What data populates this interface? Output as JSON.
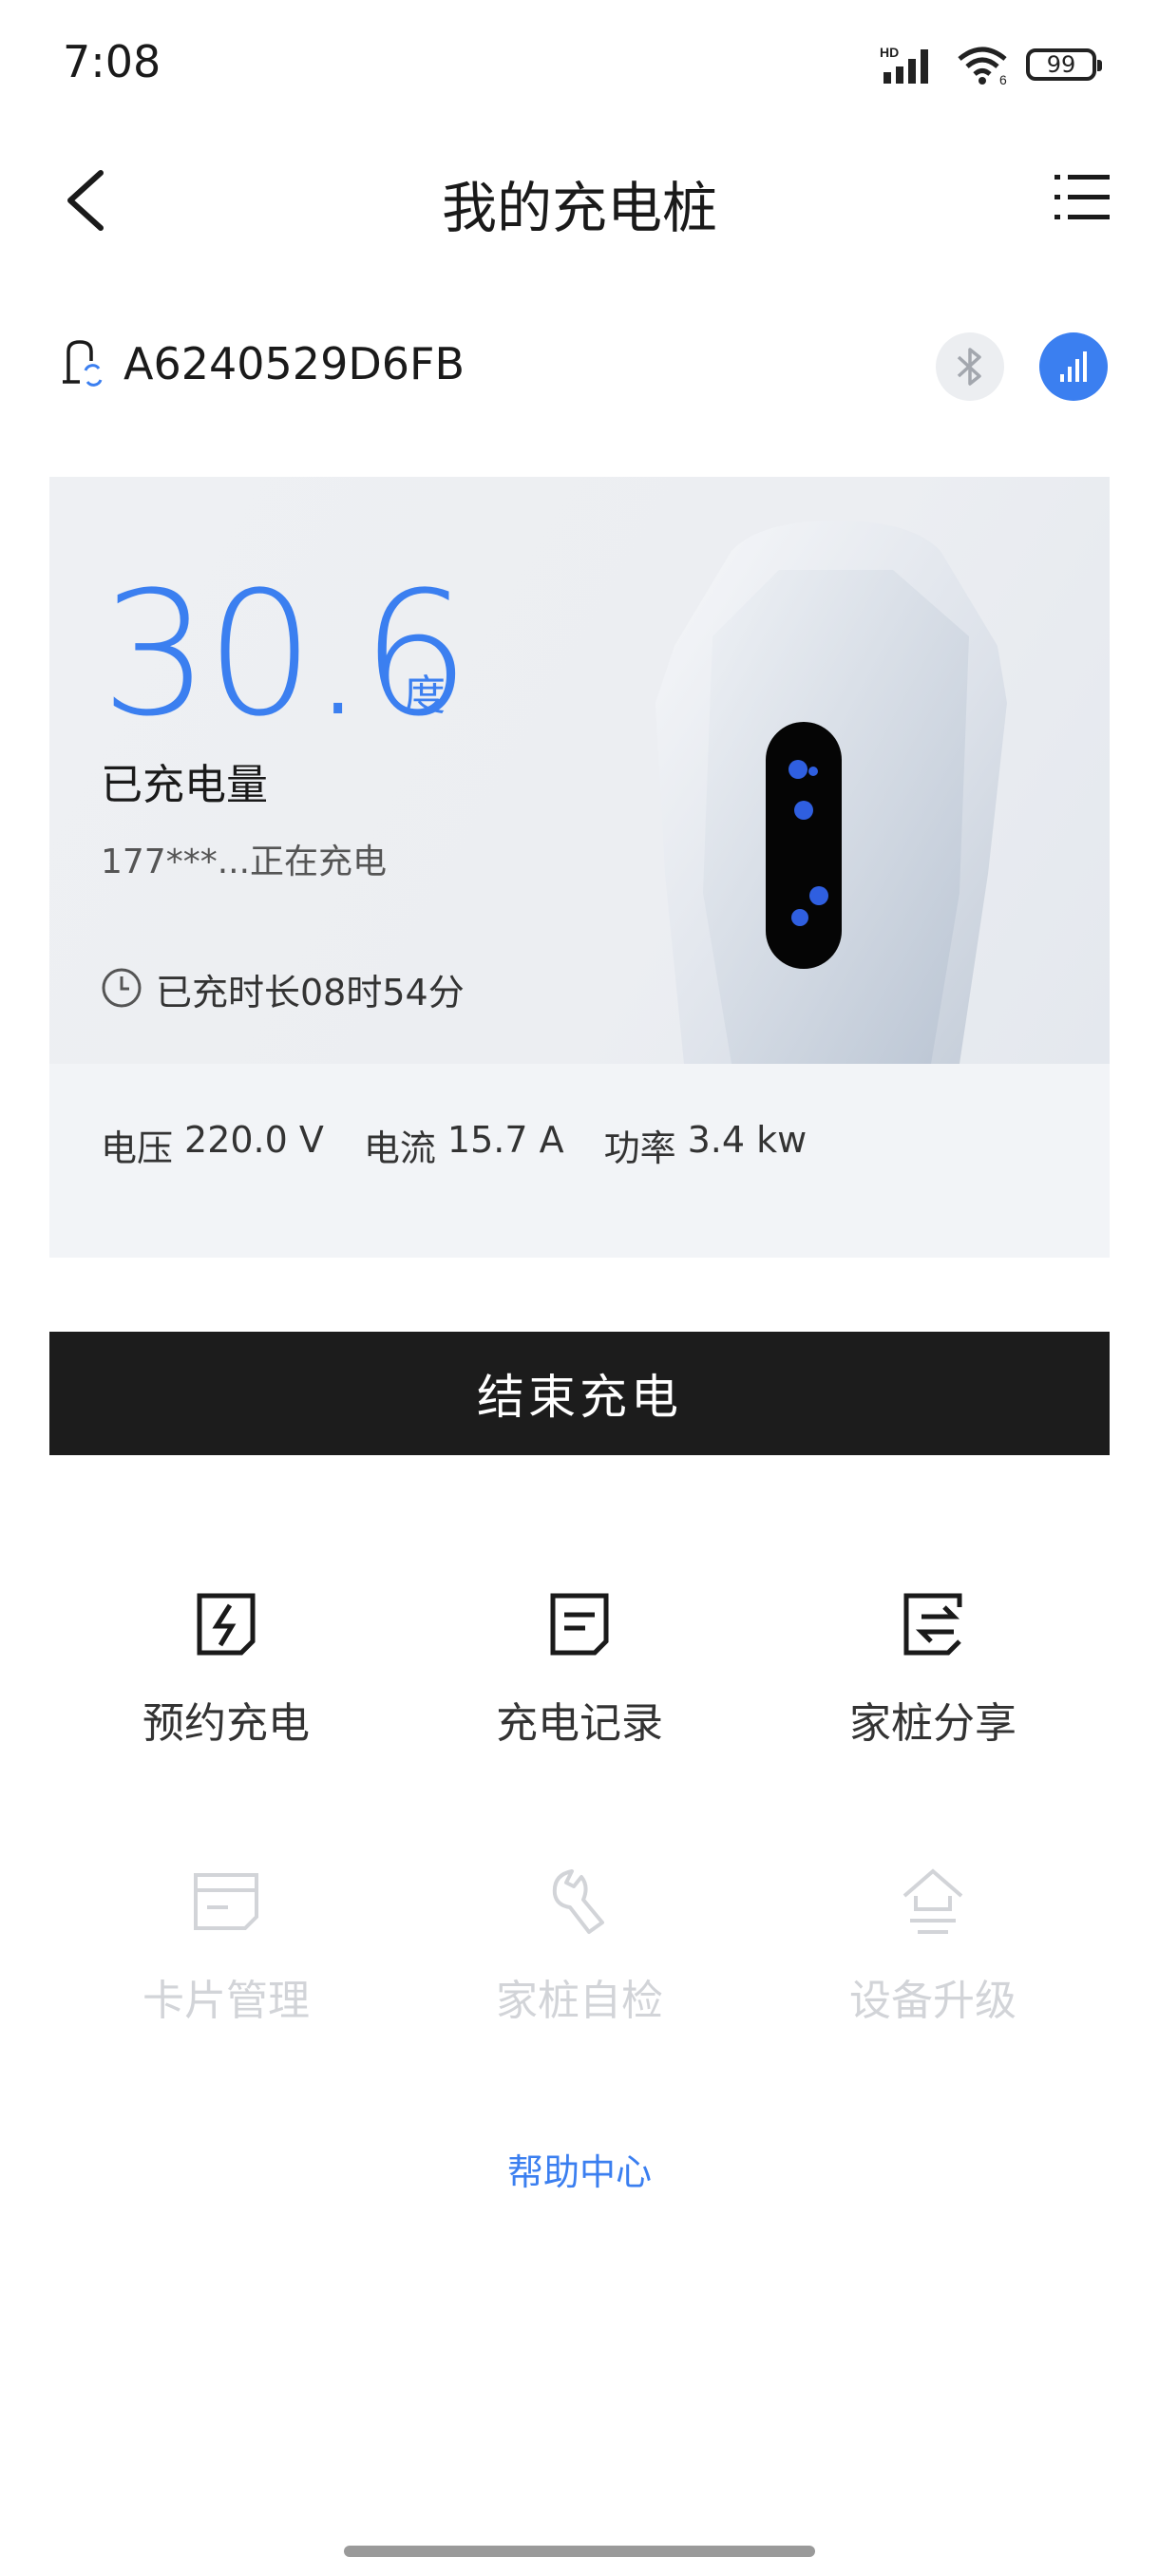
{
  "status_bar": {
    "time": "7:08",
    "network": "HD",
    "wifi_badge": "6",
    "battery": "99"
  },
  "header": {
    "title": "我的充电桩"
  },
  "device": {
    "id": "A6240529D6FB",
    "bluetooth_icon": "bluetooth-icon",
    "signal_icon": "signal-icon"
  },
  "charging": {
    "energy_value": "30.6",
    "energy_unit": "度",
    "energy_label": "已充电量",
    "user_status": "177***...正在充电",
    "duration": "已充时长08时54分",
    "metrics": [
      {
        "label": "电压",
        "value": "220.0 V"
      },
      {
        "label": "电流",
        "value": "15.7 A"
      },
      {
        "label": "功率",
        "value": "3.4 kw"
      }
    ]
  },
  "actions": {
    "end_charging": "结束充电"
  },
  "grid": {
    "row1": [
      {
        "label": "预约充电",
        "icon": "scheduled-charge-icon"
      },
      {
        "label": "充电记录",
        "icon": "charge-record-icon"
      },
      {
        "label": "家桩分享",
        "icon": "share-icon"
      }
    ],
    "row2": [
      {
        "label": "卡片管理",
        "icon": "card-icon"
      },
      {
        "label": "家桩自检",
        "icon": "wrench-icon"
      },
      {
        "label": "设备升级",
        "icon": "upgrade-icon"
      }
    ]
  },
  "help": "帮助中心",
  "colors": {
    "accent": "#3b7ff0",
    "button_dark": "#1c1c1c",
    "card_bg": "#f2f4f7",
    "disabled": "#d2d4d8"
  }
}
